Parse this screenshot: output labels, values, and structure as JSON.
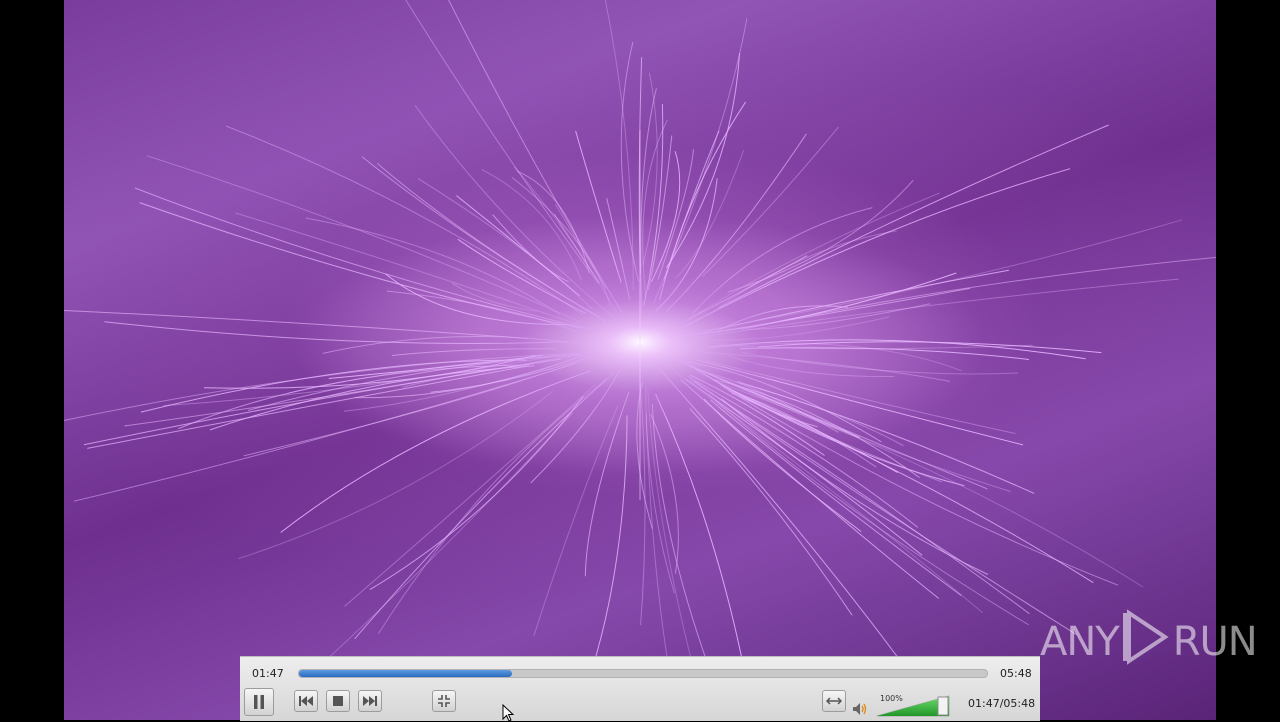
{
  "player": {
    "elapsed": "01:47",
    "total": "05:48",
    "time_readout": "01:47/05:48",
    "progress_fraction": 0.31,
    "volume_percent_label": "100%",
    "volume_level": 1.0
  },
  "buttons": {
    "pause": "pause-icon",
    "previous": "skip-previous-icon",
    "stop": "stop-icon",
    "next": "skip-next-icon",
    "fullscreen": "exit-fullscreen-icon",
    "loop": "loop-icon",
    "volume": "speaker-icon"
  },
  "watermark": {
    "left": "ANY",
    "right": "RUN"
  },
  "colors": {
    "accent": "#3a7ad0",
    "volume_green": "#3cb43c",
    "video_purple": "#8549ab"
  }
}
